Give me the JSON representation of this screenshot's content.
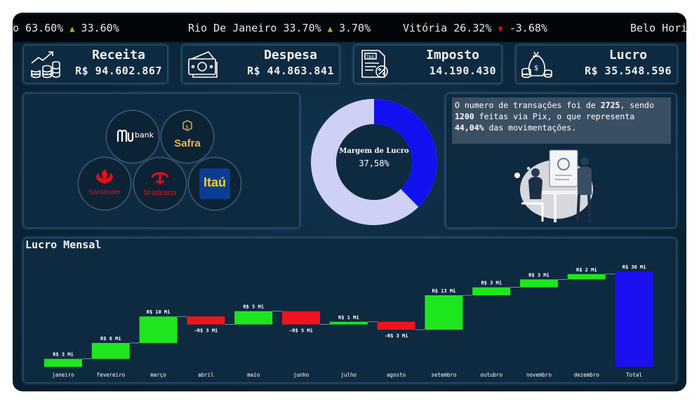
{
  "ticker": [
    {
      "text": "o 63.60%",
      "arrow": "▲",
      "dir": "up",
      "change": "33.60%"
    },
    {
      "text": "Rio De Janeiro 33.70%",
      "arrow": "▲",
      "dir": "up",
      "change": "3.70%"
    },
    {
      "text": "Vitória 26.32%",
      "arrow": "▼",
      "dir": "down",
      "change": "-3.68%"
    },
    {
      "text": "Belo Hori",
      "arrow": "",
      "dir": "",
      "change": ""
    }
  ],
  "kpis": {
    "receita": {
      "title": "Receita",
      "value": "R$ 94.602.867",
      "icon": "revenue-growth-icon"
    },
    "despesa": {
      "title": "Despesa",
      "value": "R$ 44.863.841",
      "icon": "cash-bills-icon"
    },
    "imposto": {
      "title": "Imposto",
      "value": "14.190.430",
      "icon": "tax-document-icon"
    },
    "lucro": {
      "title": "Lucro",
      "value": "R$ 35.548.596",
      "icon": "money-bag-icon"
    }
  },
  "banks": {
    "nubank": "bank",
    "safra": "Safra",
    "santander": "Santander",
    "bradesco": "bradesco",
    "itau": "Itaú"
  },
  "donut": {
    "label": "Margem de Lucro",
    "value_text": "37,58%",
    "percent": 37.58,
    "colors": {
      "fill": "#1212f0",
      "rest": "#cfd0f5",
      "center": "#0d2a40"
    }
  },
  "note": {
    "p1": "O numero de transações foi de ",
    "n1": "2725",
    "p2": ", sendo ",
    "n2": "1200",
    "p3": " feitas via Pix, o que representa ",
    "n3": "44,04%",
    "p4": " das movimentações."
  },
  "colors": {
    "up": "#1ee61e",
    "down": "#f0141e",
    "total": "#1a10f0"
  },
  "chart_data": {
    "type": "waterfall",
    "title": "Lucro Mensal",
    "categories": [
      "janeiro",
      "fevereiro",
      "março",
      "abril",
      "maio",
      "junho",
      "julho",
      "agosto",
      "setembro",
      "outubro",
      "novembro",
      "dezembro",
      "Total"
    ],
    "values": [
      3,
      6,
      10,
      -3,
      5,
      -5,
      1,
      -3,
      13,
      3,
      3,
      2,
      36
    ],
    "data_labels": [
      "R$ 3 Mi",
      "R$ 6 Mi",
      "R$ 10 Mi",
      "-R$ 3 Mi",
      "R$ 5 Mi",
      "-R$ 5 Mi",
      "R$ 1 Mi",
      "-R$ 3 Mi",
      "R$ 13 Mi",
      "R$ 3 Mi",
      "R$ 3 Mi",
      "R$ 2 Mi",
      "R$ 36 Mi"
    ],
    "unit": "Mi",
    "total_index": 12
  }
}
